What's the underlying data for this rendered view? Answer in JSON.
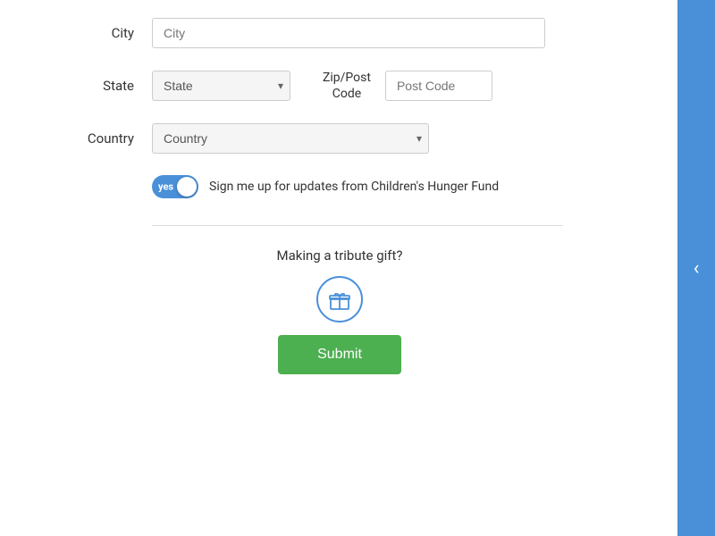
{
  "form": {
    "city_label": "City",
    "city_placeholder": "City",
    "state_label": "State",
    "state_placeholder": "State",
    "zip_label": "Zip/Post\nCode",
    "zip_placeholder": "Post Code",
    "country_label": "Country",
    "country_placeholder": "Country",
    "toggle_yes": "yes",
    "toggle_text": "Sign me up for updates from Children's Hunger Fund",
    "tribute_title": "Making a tribute gift?",
    "submit_label": "Submit"
  },
  "sidebar": {
    "arrow_icon": "arrow-left"
  }
}
